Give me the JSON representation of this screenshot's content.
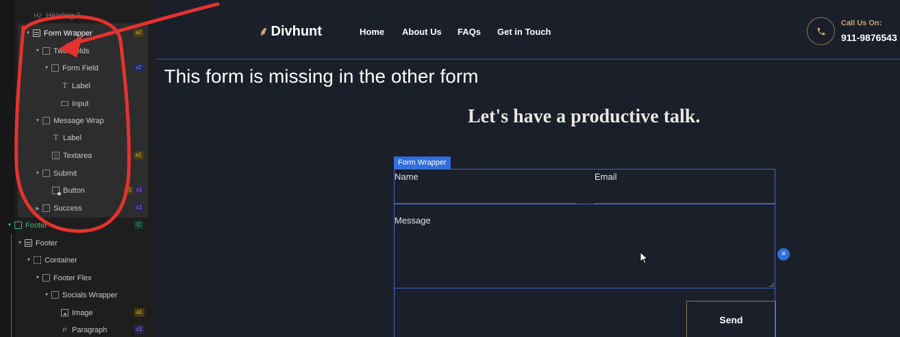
{
  "navigator": {
    "rows": [
      {
        "label": "Heading 2",
        "prefix": "H2",
        "badge": ""
      },
      {
        "label": "Form Wrapper",
        "badge": "a2"
      },
      {
        "label": "Two Fields",
        "badge": ""
      },
      {
        "label": "Form Field",
        "badge": "x2"
      },
      {
        "label": "Label",
        "badge": ""
      },
      {
        "label": "Input",
        "badge": ""
      },
      {
        "label": "Message Wrap",
        "badge": ""
      },
      {
        "label": "Label",
        "badge": ""
      },
      {
        "label": "Textarea",
        "badge": "a1"
      },
      {
        "label": "Submit",
        "badge": ""
      },
      {
        "label": "Button",
        "badge": "c1",
        "badge2": "a1"
      },
      {
        "label": "Success",
        "badge": "c1"
      },
      {
        "label": "Footer",
        "badge": "C"
      },
      {
        "label": "Footer",
        "badge": ""
      },
      {
        "label": "Container",
        "badge": ""
      },
      {
        "label": "Footer Flex",
        "badge": ""
      },
      {
        "label": "Socials Wrapper",
        "badge": ""
      },
      {
        "label": "Image",
        "badge": "a1"
      },
      {
        "label": "Paragraph",
        "badge": "c1"
      }
    ]
  },
  "site": {
    "brand": "Divhunt",
    "nav": [
      "Home",
      "About Us",
      "FAQs",
      "Get in Touch"
    ],
    "call_label": "Call Us On:",
    "call_number": "911-9876543",
    "headline": "Let's have a productive talk."
  },
  "annotation": "This form is missing in the other form",
  "form": {
    "tag": "Form Wrapper",
    "name_label": "Name",
    "email_label": "Email",
    "message_label": "Message",
    "send_label": "Send"
  },
  "icons": {
    "handle": "list-icon",
    "phone": "phone-icon",
    "cursor": "mouse-pointer-icon"
  },
  "colors": {
    "annotation_red": "#e5322e",
    "accent_gold": "#c9a96a",
    "selection_blue": "#2f6fde",
    "canvas_bg": "#1b1f2a",
    "panel_bg": "#1e1e1e"
  }
}
